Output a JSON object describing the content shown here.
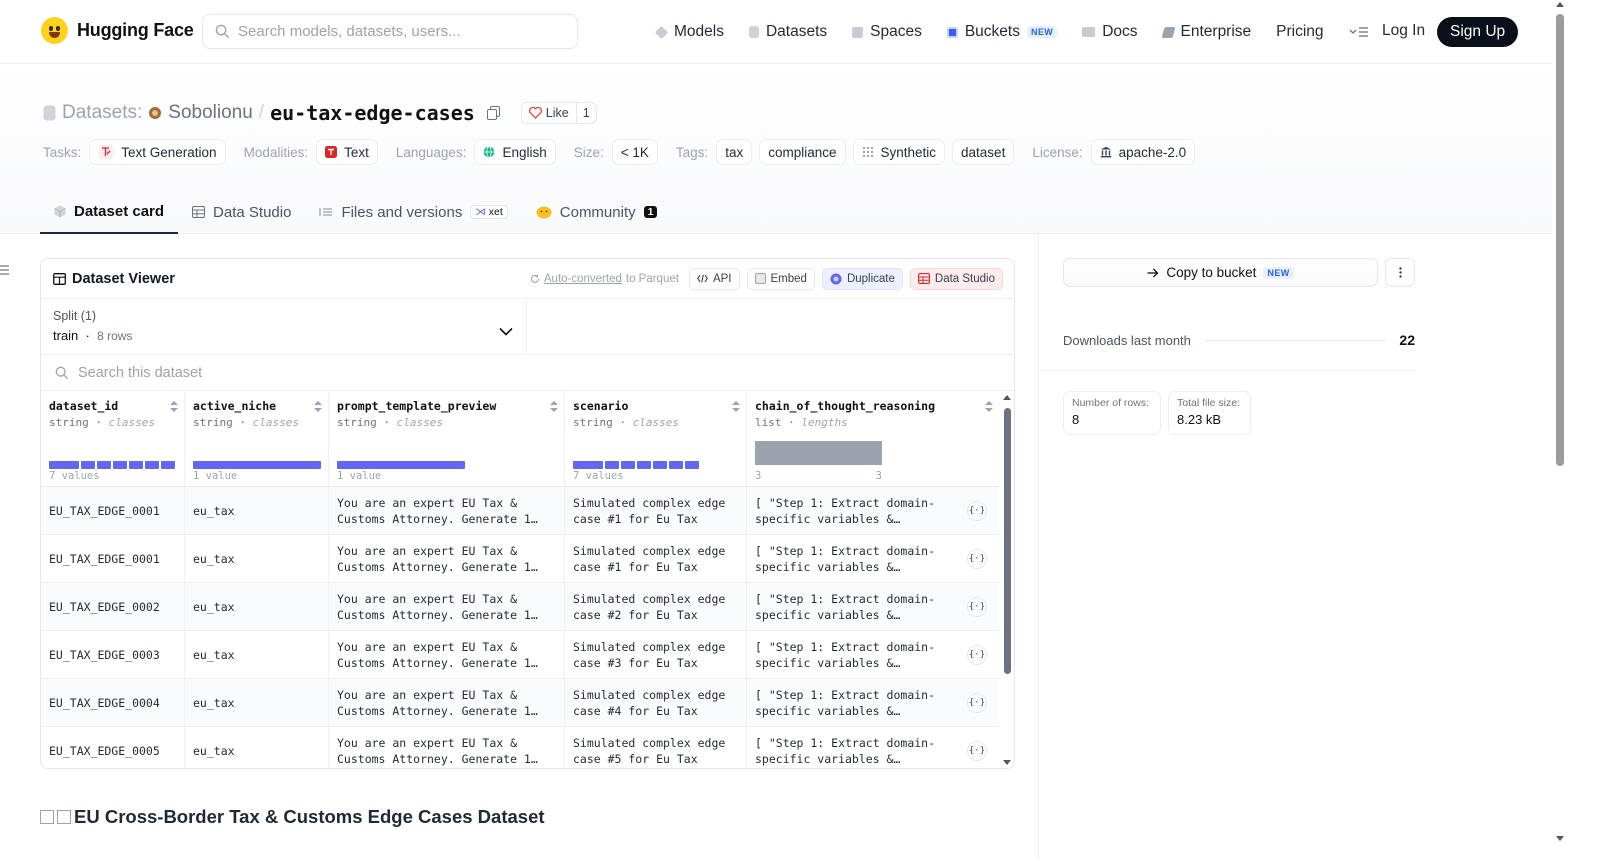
{
  "nav": {
    "brand": "Hugging Face",
    "search_placeholder": "Search models, datasets, users...",
    "links": [
      {
        "label": "Models",
        "icon": "model-icon"
      },
      {
        "label": "Datasets",
        "icon": "database-icon"
      },
      {
        "label": "Spaces",
        "icon": "grid-icon"
      },
      {
        "label": "Buckets",
        "icon": "bucket-icon",
        "badge": "NEW"
      },
      {
        "label": "Docs",
        "icon": "book-icon"
      },
      {
        "label": "Enterprise",
        "icon": "enterprise-icon"
      },
      {
        "label": "Pricing"
      }
    ],
    "login": "Log In",
    "signup": "Sign Up"
  },
  "header": {
    "section_label": "Datasets:",
    "owner": "Sobolionu",
    "repo": "eu-tax-edge-cases",
    "like_label": "Like",
    "like_count": "1",
    "tags": {
      "tasks_label": "Tasks:",
      "tasks": [
        "Text Generation"
      ],
      "modalities_label": "Modalities:",
      "modalities": [
        "Text"
      ],
      "languages_label": "Languages:",
      "languages": [
        "English"
      ],
      "size_label": "Size:",
      "size": "< 1K",
      "tags_label": "Tags:",
      "tags": [
        "tax",
        "compliance",
        "Synthetic",
        "dataset"
      ],
      "license_label": "License:",
      "license": "apache-2.0"
    }
  },
  "tabs": [
    {
      "label": "Dataset card",
      "active": true
    },
    {
      "label": "Data Studio"
    },
    {
      "label": "Files and versions",
      "badge": "xet"
    },
    {
      "label": "Community",
      "count": "1"
    }
  ],
  "viewer": {
    "title": "Dataset Viewer",
    "auto_converted": "Auto-converted",
    "auto_converted_suffix": "to Parquet",
    "actions": [
      "API",
      "Embed",
      "Duplicate",
      "Data Studio"
    ],
    "split_label": "Split (1)",
    "split_value": "train",
    "split_rows": "8 rows",
    "search_placeholder": "Search this dataset",
    "columns": [
      {
        "name": "dataset_id",
        "type": "string",
        "kind": "classes",
        "caption": "7 values"
      },
      {
        "name": "active_niche",
        "type": "string",
        "kind": "classes",
        "caption": "1 value"
      },
      {
        "name": "prompt_template_preview",
        "type": "string",
        "kind": "classes",
        "caption": "1 value"
      },
      {
        "name": "scenario",
        "type": "string",
        "kind": "classes",
        "caption": "7 values"
      },
      {
        "name": "chain_of_thought_reasoning",
        "type": "list",
        "kind": "lengths",
        "len_min": "3",
        "len_max": "3"
      }
    ],
    "rows": [
      [
        "EU_TAX_EDGE_0001",
        "eu_tax",
        "You are an expert EU Tax &\nCustoms Attorney. Generate 1…",
        "Simulated complex edge\ncase #1 for Eu Tax",
        "[ \"Step 1: Extract domain-\nspecific variables &…"
      ],
      [
        "EU_TAX_EDGE_0001",
        "eu_tax",
        "You are an expert EU Tax &\nCustoms Attorney. Generate 1…",
        "Simulated complex edge\ncase #1 for Eu Tax",
        "[ \"Step 1: Extract domain-\nspecific variables &…"
      ],
      [
        "EU_TAX_EDGE_0002",
        "eu_tax",
        "You are an expert EU Tax &\nCustoms Attorney. Generate 1…",
        "Simulated complex edge\ncase #2 for Eu Tax",
        "[ \"Step 1: Extract domain-\nspecific variables &…"
      ],
      [
        "EU_TAX_EDGE_0003",
        "eu_tax",
        "You are an expert EU Tax &\nCustoms Attorney. Generate 1…",
        "Simulated complex edge\ncase #3 for Eu Tax",
        "[ \"Step 1: Extract domain-\nspecific variables &…"
      ],
      [
        "EU_TAX_EDGE_0004",
        "eu_tax",
        "You are an expert EU Tax &\nCustoms Attorney. Generate 1…",
        "Simulated complex edge\ncase #4 for Eu Tax",
        "[ \"Step 1: Extract domain-\nspecific variables &…"
      ],
      [
        "EU_TAX_EDGE_0005",
        "eu_tax",
        "You are an expert EU Tax &\nCustoms Attorney. Generate 1…",
        "Simulated complex edge\ncase #5 for Eu Tax",
        "[ \"Step 1: Extract domain-\nspecific variables &…"
      ]
    ]
  },
  "readme": {
    "title": "EU Cross-Border Tax & Customs Edge Cases Dataset"
  },
  "sidebar": {
    "copy_label": "Copy to bucket",
    "copy_badge": "NEW",
    "downloads_label": "Downloads last month",
    "downloads_value": "22",
    "rows_label": "Number of rows:",
    "rows_value": "8",
    "size_label": "Total file size:",
    "size_value": "8.23 kB"
  },
  "colors": {
    "accent": "#6366f1",
    "brand": "#ffd21e",
    "signup_bg": "#0b0f1a"
  }
}
